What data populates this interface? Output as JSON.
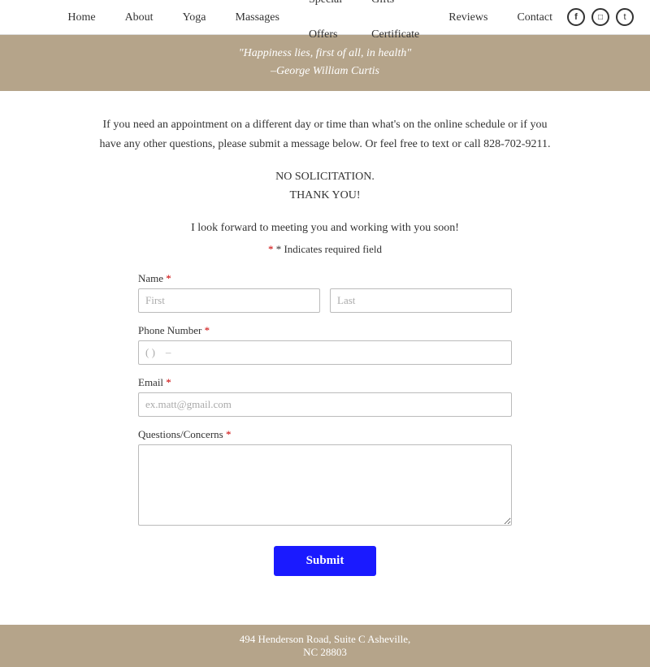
{
  "nav": {
    "links": [
      {
        "label": "Home",
        "name": "home"
      },
      {
        "label": "About",
        "name": "about"
      },
      {
        "label": "Yoga",
        "name": "yoga"
      },
      {
        "label": "Massages",
        "name": "massages"
      },
      {
        "label": "Special Offers",
        "name": "special-offers"
      },
      {
        "label": "Gifts Certificate",
        "name": "gifts-certificate"
      },
      {
        "label": "Reviews",
        "name": "reviews"
      },
      {
        "label": "Contact",
        "name": "contact"
      }
    ],
    "social": [
      {
        "icon": "f",
        "name": "facebook"
      },
      {
        "icon": "⬜",
        "name": "instagram"
      },
      {
        "icon": "t",
        "name": "twitter"
      }
    ]
  },
  "hero": {
    "quote": "\"Happiness lies, first of all, in health\"",
    "attribution": "–George William Curtis"
  },
  "main": {
    "intro": "If you need an appointment on a different day or time than what's on the online schedule or if you have any other questions, please submit a message below. Or feel free to text or call 828-702-9211.",
    "no_solicit": "NO SOLICITATION.\nTHANK YOU!",
    "looking_forward": "I look forward to meeting you and working with you soon!",
    "required_note": "* Indicates required field"
  },
  "form": {
    "name_label": "Name",
    "name_required": "*",
    "first_placeholder": "First",
    "last_placeholder": "Last",
    "phone_label": "Phone Number",
    "phone_required": "*",
    "phone_placeholder": "( )    –",
    "email_label": "Email",
    "email_required": "*",
    "email_placeholder": "ex.matt@gmail.com",
    "questions_label": "Questions/Concerns",
    "questions_required": "*",
    "submit_label": "Submit"
  },
  "footer": {
    "address": "494 Henderson Road, Suite C Asheville,",
    "city": "NC 28803"
  }
}
